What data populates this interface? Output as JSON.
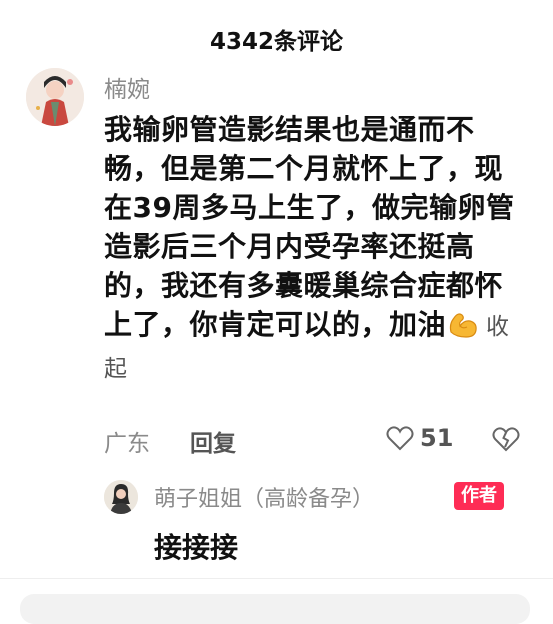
{
  "header": {
    "title": "4342条评论"
  },
  "comment": {
    "username": "楠婉",
    "text": "我输卵管造影结果也是通而不畅，但是第二个月就怀上了，现在39周多马上生了，做完输卵管造影后三个月内受孕率还挺高的，我还有多囊暖巢综合症都怀上了，你肯定可以的，加油",
    "emoji": "flexed-biceps-icon",
    "collapse_label": "收起",
    "location": "广东",
    "reply_label": "回复",
    "likes": "51"
  },
  "reply": {
    "author": "萌子姐姐（高龄备孕）",
    "badge": "作者",
    "text": "接接接"
  },
  "colors": {
    "accent_badge": "#fe2c55",
    "secondary_text": "#8a8a8a"
  }
}
